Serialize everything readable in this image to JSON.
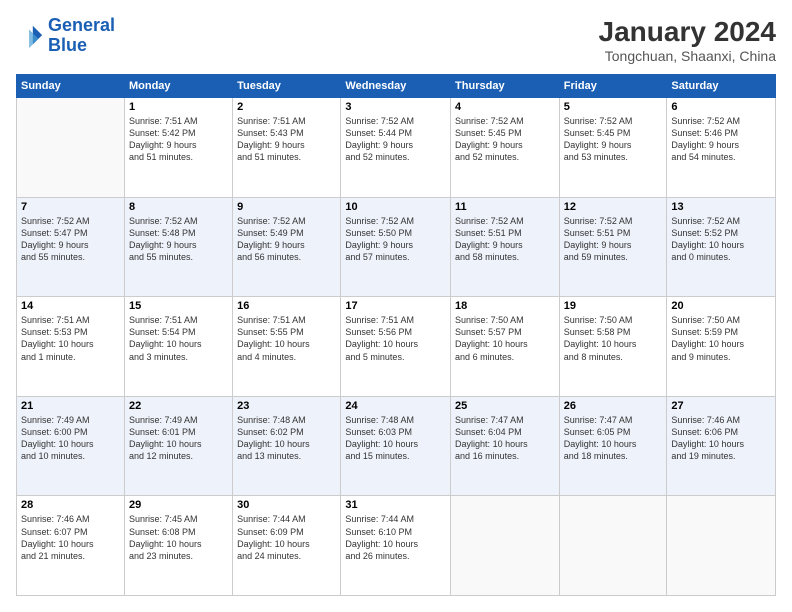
{
  "logo": {
    "line1": "General",
    "line2": "Blue"
  },
  "title": "January 2024",
  "subtitle": "Tongchuan, Shaanxi, China",
  "weekdays": [
    "Sunday",
    "Monday",
    "Tuesday",
    "Wednesday",
    "Thursday",
    "Friday",
    "Saturday"
  ],
  "weeks": [
    [
      {
        "day": "",
        "info": ""
      },
      {
        "day": "1",
        "info": "Sunrise: 7:51 AM\nSunset: 5:42 PM\nDaylight: 9 hours\nand 51 minutes."
      },
      {
        "day": "2",
        "info": "Sunrise: 7:51 AM\nSunset: 5:43 PM\nDaylight: 9 hours\nand 51 minutes."
      },
      {
        "day": "3",
        "info": "Sunrise: 7:52 AM\nSunset: 5:44 PM\nDaylight: 9 hours\nand 52 minutes."
      },
      {
        "day": "4",
        "info": "Sunrise: 7:52 AM\nSunset: 5:45 PM\nDaylight: 9 hours\nand 52 minutes."
      },
      {
        "day": "5",
        "info": "Sunrise: 7:52 AM\nSunset: 5:45 PM\nDaylight: 9 hours\nand 53 minutes."
      },
      {
        "day": "6",
        "info": "Sunrise: 7:52 AM\nSunset: 5:46 PM\nDaylight: 9 hours\nand 54 minutes."
      }
    ],
    [
      {
        "day": "7",
        "info": "Sunrise: 7:52 AM\nSunset: 5:47 PM\nDaylight: 9 hours\nand 55 minutes."
      },
      {
        "day": "8",
        "info": "Sunrise: 7:52 AM\nSunset: 5:48 PM\nDaylight: 9 hours\nand 55 minutes."
      },
      {
        "day": "9",
        "info": "Sunrise: 7:52 AM\nSunset: 5:49 PM\nDaylight: 9 hours\nand 56 minutes."
      },
      {
        "day": "10",
        "info": "Sunrise: 7:52 AM\nSunset: 5:50 PM\nDaylight: 9 hours\nand 57 minutes."
      },
      {
        "day": "11",
        "info": "Sunrise: 7:52 AM\nSunset: 5:51 PM\nDaylight: 9 hours\nand 58 minutes."
      },
      {
        "day": "12",
        "info": "Sunrise: 7:52 AM\nSunset: 5:51 PM\nDaylight: 9 hours\nand 59 minutes."
      },
      {
        "day": "13",
        "info": "Sunrise: 7:52 AM\nSunset: 5:52 PM\nDaylight: 10 hours\nand 0 minutes."
      }
    ],
    [
      {
        "day": "14",
        "info": "Sunrise: 7:51 AM\nSunset: 5:53 PM\nDaylight: 10 hours\nand 1 minute."
      },
      {
        "day": "15",
        "info": "Sunrise: 7:51 AM\nSunset: 5:54 PM\nDaylight: 10 hours\nand 3 minutes."
      },
      {
        "day": "16",
        "info": "Sunrise: 7:51 AM\nSunset: 5:55 PM\nDaylight: 10 hours\nand 4 minutes."
      },
      {
        "day": "17",
        "info": "Sunrise: 7:51 AM\nSunset: 5:56 PM\nDaylight: 10 hours\nand 5 minutes."
      },
      {
        "day": "18",
        "info": "Sunrise: 7:50 AM\nSunset: 5:57 PM\nDaylight: 10 hours\nand 6 minutes."
      },
      {
        "day": "19",
        "info": "Sunrise: 7:50 AM\nSunset: 5:58 PM\nDaylight: 10 hours\nand 8 minutes."
      },
      {
        "day": "20",
        "info": "Sunrise: 7:50 AM\nSunset: 5:59 PM\nDaylight: 10 hours\nand 9 minutes."
      }
    ],
    [
      {
        "day": "21",
        "info": "Sunrise: 7:49 AM\nSunset: 6:00 PM\nDaylight: 10 hours\nand 10 minutes."
      },
      {
        "day": "22",
        "info": "Sunrise: 7:49 AM\nSunset: 6:01 PM\nDaylight: 10 hours\nand 12 minutes."
      },
      {
        "day": "23",
        "info": "Sunrise: 7:48 AM\nSunset: 6:02 PM\nDaylight: 10 hours\nand 13 minutes."
      },
      {
        "day": "24",
        "info": "Sunrise: 7:48 AM\nSunset: 6:03 PM\nDaylight: 10 hours\nand 15 minutes."
      },
      {
        "day": "25",
        "info": "Sunrise: 7:47 AM\nSunset: 6:04 PM\nDaylight: 10 hours\nand 16 minutes."
      },
      {
        "day": "26",
        "info": "Sunrise: 7:47 AM\nSunset: 6:05 PM\nDaylight: 10 hours\nand 18 minutes."
      },
      {
        "day": "27",
        "info": "Sunrise: 7:46 AM\nSunset: 6:06 PM\nDaylight: 10 hours\nand 19 minutes."
      }
    ],
    [
      {
        "day": "28",
        "info": "Sunrise: 7:46 AM\nSunset: 6:07 PM\nDaylight: 10 hours\nand 21 minutes."
      },
      {
        "day": "29",
        "info": "Sunrise: 7:45 AM\nSunset: 6:08 PM\nDaylight: 10 hours\nand 23 minutes."
      },
      {
        "day": "30",
        "info": "Sunrise: 7:44 AM\nSunset: 6:09 PM\nDaylight: 10 hours\nand 24 minutes."
      },
      {
        "day": "31",
        "info": "Sunrise: 7:44 AM\nSunset: 6:10 PM\nDaylight: 10 hours\nand 26 minutes."
      },
      {
        "day": "",
        "info": ""
      },
      {
        "day": "",
        "info": ""
      },
      {
        "day": "",
        "info": ""
      }
    ]
  ]
}
